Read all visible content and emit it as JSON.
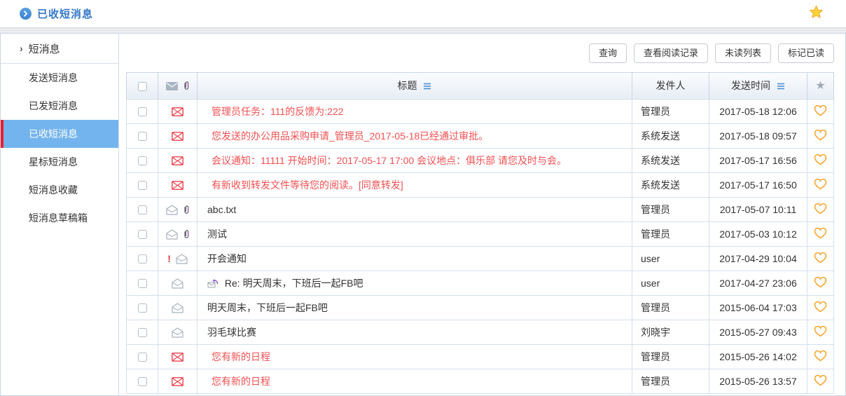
{
  "page": {
    "title": "已收短消息"
  },
  "sidebar": {
    "header": "短消息",
    "items": [
      {
        "label": "发送短消息",
        "active": false
      },
      {
        "label": "已发短消息",
        "active": false
      },
      {
        "label": "已收短消息",
        "active": true
      },
      {
        "label": "星标短消息",
        "active": false
      },
      {
        "label": "短消息收藏",
        "active": false
      },
      {
        "label": "短消息草稿箱",
        "active": false
      }
    ]
  },
  "toolbar": {
    "buttons": [
      "查询",
      "查看阅读记录",
      "未读列表",
      "标记已读"
    ]
  },
  "table": {
    "headers": {
      "title": "标题",
      "sender": "发件人",
      "time": "发送时间"
    },
    "rows": [
      {
        "title": "管理员任务：111的反馈为:222",
        "sender": "管理员",
        "time": "2017-05-18 12:06",
        "unread": true,
        "attachment": false,
        "priority": false,
        "reply": false
      },
      {
        "title": "您发送的办公用品采购申请_管理员_2017-05-18已经通过审批。",
        "sender": "系统发送",
        "time": "2017-05-18 09:57",
        "unread": true,
        "attachment": false,
        "priority": false,
        "reply": false
      },
      {
        "title": "会议通知：11111 开始时间：2017-05-17 17:00 会议地点：俱乐部 请您及时与会。",
        "sender": "系统发送",
        "time": "2017-05-17 16:56",
        "unread": true,
        "attachment": false,
        "priority": false,
        "reply": false
      },
      {
        "title": "有新收到转发文件等待您的阅读。[同意转发]",
        "sender": "系统发送",
        "time": "2017-05-17 16:50",
        "unread": true,
        "attachment": false,
        "priority": false,
        "reply": false
      },
      {
        "title": "abc.txt",
        "sender": "管理员",
        "time": "2017-05-07 10:11",
        "unread": false,
        "attachment": true,
        "priority": false,
        "reply": false
      },
      {
        "title": "测试",
        "sender": "管理员",
        "time": "2017-05-03 10:12",
        "unread": false,
        "attachment": true,
        "priority": false,
        "reply": false
      },
      {
        "title": "开会通知",
        "sender": "user",
        "time": "2017-04-29 10:04",
        "unread": false,
        "attachment": false,
        "priority": true,
        "reply": false
      },
      {
        "title": "Re: 明天周末，下班后一起FB吧",
        "sender": "user",
        "time": "2017-04-27 23:06",
        "unread": false,
        "attachment": false,
        "priority": false,
        "reply": true
      },
      {
        "title": "明天周末，下班后一起FB吧",
        "sender": "管理员",
        "time": "2015-06-04 17:03",
        "unread": false,
        "attachment": false,
        "priority": false,
        "reply": false
      },
      {
        "title": "羽毛球比赛",
        "sender": "刘晓宇",
        "time": "2015-05-27 09:43",
        "unread": false,
        "attachment": false,
        "priority": false,
        "reply": false
      },
      {
        "title": "您有新的日程",
        "sender": "管理员",
        "time": "2015-05-26 14:02",
        "unread": true,
        "attachment": false,
        "priority": false,
        "reply": false
      },
      {
        "title": "您有新的日程",
        "sender": "管理员",
        "time": "2015-05-26 13:57",
        "unread": true,
        "attachment": false,
        "priority": false,
        "reply": false
      }
    ]
  },
  "icons": {
    "unread_envelope": "red-closed-envelope",
    "read_envelope": "gray-open-envelope",
    "favorite": "orange-heart-outline",
    "page_favorite": "gold-star"
  },
  "colors": {
    "accent_blue": "#3578c7",
    "active_item_bg": "#74b4ee",
    "active_item_bar": "#ee1c2d",
    "unread_red": "#f25052",
    "heart_orange": "#f5a329",
    "star_gold": "#ffd43a"
  }
}
